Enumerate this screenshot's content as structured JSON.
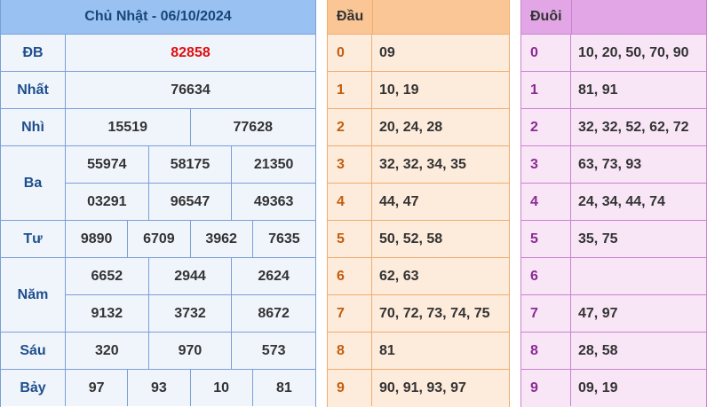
{
  "results": {
    "title": "Chủ Nhật - 06/10/2024",
    "prizes": [
      {
        "label": "ĐB",
        "numbers": [
          "82858"
        ]
      },
      {
        "label": "Nhất",
        "numbers": [
          "76634"
        ]
      },
      {
        "label": "Nhì",
        "numbers": [
          "15519",
          "77628"
        ]
      },
      {
        "label": "Ba",
        "numbers": [
          "55974",
          "58175",
          "21350",
          "03291",
          "96547",
          "49363"
        ]
      },
      {
        "label": "Tư",
        "numbers": [
          "9890",
          "6709",
          "3962",
          "7635"
        ]
      },
      {
        "label": "Năm",
        "numbers": [
          "6652",
          "2944",
          "2624",
          "9132",
          "3732",
          "8672"
        ]
      },
      {
        "label": "Sáu",
        "numbers": [
          "320",
          "970",
          "573"
        ]
      },
      {
        "label": "Bảy",
        "numbers": [
          "97",
          "93",
          "10",
          "81"
        ]
      }
    ],
    "special_color": "#e10e0e"
  },
  "dau": {
    "header_key": "Đầu",
    "header_value": "",
    "rows": [
      {
        "key": "0",
        "value": "09"
      },
      {
        "key": "1",
        "value": "10, 19"
      },
      {
        "key": "2",
        "value": "20, 24, 28"
      },
      {
        "key": "3",
        "value": "32, 32, 34, 35"
      },
      {
        "key": "4",
        "value": "44, 47"
      },
      {
        "key": "5",
        "value": "50, 52, 58"
      },
      {
        "key": "6",
        "value": "62, 63"
      },
      {
        "key": "7",
        "value": "70, 72, 73, 74, 75"
      },
      {
        "key": "8",
        "value": "81"
      },
      {
        "key": "9",
        "value": "90, 91, 93, 97"
      }
    ]
  },
  "duoi": {
    "header_key": "Đuôi",
    "header_value": "",
    "rows": [
      {
        "key": "0",
        "value": "10, 20, 50, 70, 90"
      },
      {
        "key": "1",
        "value": "81, 91"
      },
      {
        "key": "2",
        "value": "32, 32, 52, 62, 72"
      },
      {
        "key": "3",
        "value": "63, 73, 93"
      },
      {
        "key": "4",
        "value": "24, 34, 44, 74"
      },
      {
        "key": "5",
        "value": "35, 75"
      },
      {
        "key": "6",
        "value": ""
      },
      {
        "key": "7",
        "value": "47, 97"
      },
      {
        "key": "8",
        "value": "28, 58"
      },
      {
        "key": "9",
        "value": "09, 19"
      }
    ]
  }
}
